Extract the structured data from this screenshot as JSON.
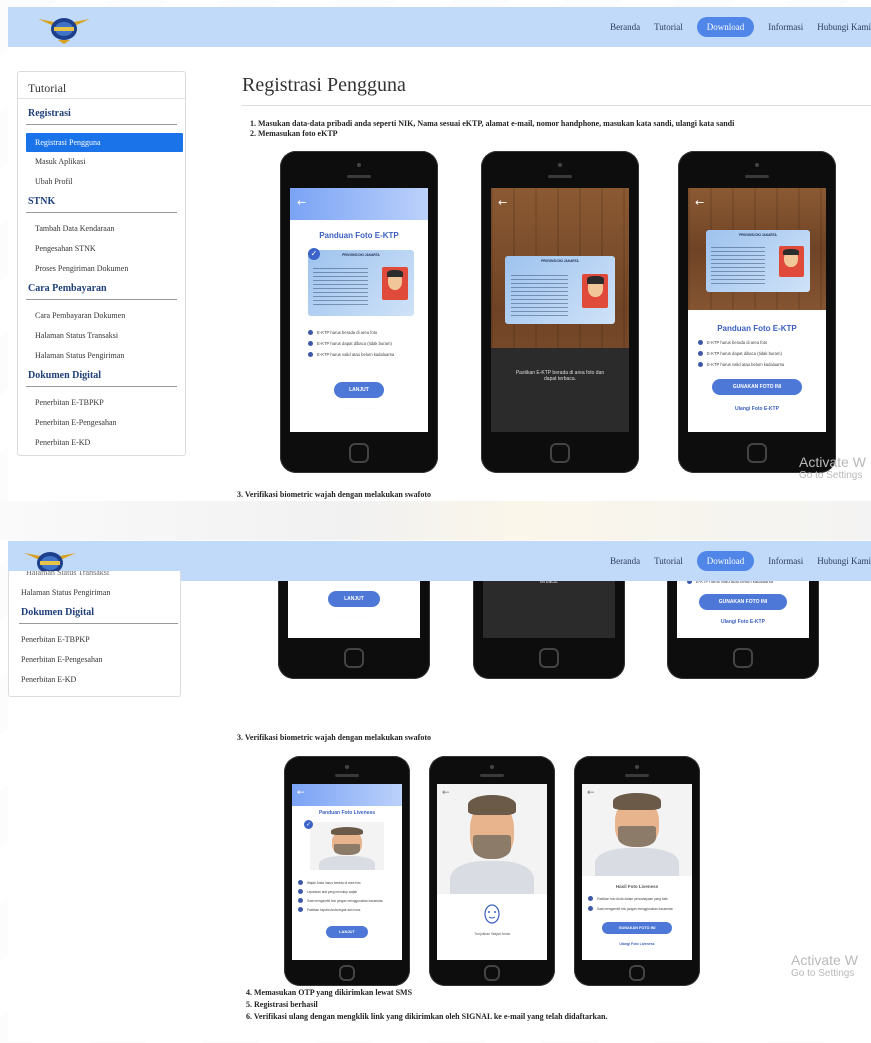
{
  "nav": {
    "items": [
      {
        "label": "Beranda",
        "active": false
      },
      {
        "label": "Tutorial",
        "active": false
      },
      {
        "label": "Download",
        "active": true
      },
      {
        "label": "Informasi",
        "active": false
      },
      {
        "label": "Hubungi Kami",
        "active": false
      }
    ]
  },
  "sidebar": {
    "title": "Tutorial",
    "sections": [
      {
        "title": "Registrasi",
        "items": [
          "Registrasi Pengguna",
          "Masuk Aplikasi",
          "Ubah Profil"
        ]
      },
      {
        "title": "STNK",
        "items": [
          "Tambah Data Kendaraan",
          "Pengesahan STNK",
          "Proses Pengiriman Dokumen"
        ]
      },
      {
        "title": "Cara Pembayaran",
        "items": [
          "Cara Pembayaran Dokumen",
          "Halaman Status Transaksi",
          "Halaman Status Pengiriman"
        ]
      },
      {
        "title": "Dokumen Digital",
        "items": [
          "Penerbitan E-TBPKP",
          "Penerbitan E-Pengesahan",
          "Penerbitan E-KD"
        ]
      }
    ],
    "active_item": "Registrasi Pengguna",
    "partial_top": "Halaman Status Transaksi"
  },
  "main": {
    "title": "Registrasi Pengguna",
    "steps": [
      "1. Masukan data-data pribadi anda seperti NIK, Nama sesuai eKTP, alamat e-mail, nomor handphone, masukan kata sandi, ulangi kata sandi",
      "2. Memasukan foto eKTP",
      "3. Verifikasi biometric wajah dengan melakukan swafoto",
      "4. Memasukan OTP yang dikirimkan lewat SMS",
      "5. Registrasi berhasil",
      "6. Verifikasi ulang dengan mengklik link yang dikirimkan oleh SIGNAL ke e-mail yang telah didaftarkan."
    ]
  },
  "phones": {
    "ktp_guide_title": "Panduan Foto E-KTP",
    "ktp_card_header": "PROVINSI DKI JAKARTA",
    "ktp_bullets": [
      "E-KTP harus berada di area foto",
      "E-KTP harus dapat dibaca (tidak buram)",
      "E-KTP harus valid atau belum kadaluarsa"
    ],
    "lanjut_label": "LANJUT",
    "camera_hint": "Pastikan E-KTP berada di area foto dan dapat terbaca.",
    "gunakan_label": "GUNAKAN FOTO INI",
    "ulangi_ktp": "Ulangi Foto E-KTP",
    "liveness_title": "Panduan Foto Liveness",
    "liveness_bullets": [
      "Wajah Anda harus berada di area foto",
      "Lepaskan alat yang menutup wajah",
      "Saat mengambil foto jangan menggunakan kacamata",
      "Pastikan kepala Anda tegak dan lurus"
    ],
    "liveness_camera_hint": "Tunjukkan Wajah Anda",
    "liveness_result_title": "Hasil Foto Liveness",
    "liveness_result_bullets": [
      "Pastikan foto Anda dalam pencahayaan yang baik",
      "Saat mengambil foto jangan menggunakan kacamata"
    ],
    "ulangi_liveness": "Ulangi Foto Liveness"
  },
  "os_watermark": {
    "line1": "Activate W",
    "line2": "Go to Settings"
  },
  "colors": {
    "navbar": "#c2dafa",
    "active_pill": "#4f86e8",
    "sidebar_active": "#1a73e8",
    "section_title": "#1f3f7a"
  }
}
